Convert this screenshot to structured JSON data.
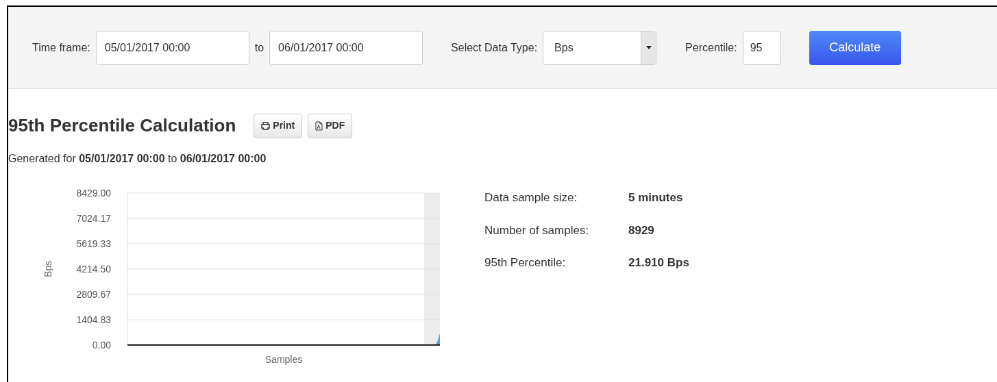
{
  "toolbar": {
    "time_frame_label": "Time frame:",
    "from": "05/01/2017 00:00",
    "to_label": "to",
    "to": "06/01/2017 00:00",
    "data_type_label": "Select Data Type:",
    "data_type": "Bps",
    "percentile_label": "Percentile:",
    "percentile": "95",
    "calculate": "Calculate"
  },
  "report": {
    "title": "95th Percentile Calculation",
    "buttons": [
      {
        "kind": "print",
        "label": "Print"
      },
      {
        "kind": "pdf",
        "label": "PDF"
      }
    ],
    "generated": "Generated for **05/01/2017 00:00** to **06/01/2017 00:00**",
    "chart_data": {
      "type": "area",
      "xlabel": "Samples",
      "ylabel": "Bps",
      "ylim": [
        0,
        8429
      ],
      "yticks": [
        {
          "value": 0,
          "label": "0.00"
        },
        {
          "value": 1404.83,
          "label": "1404.83"
        },
        {
          "value": 2809.67,
          "label": "2809.67"
        },
        {
          "value": 4214.5,
          "label": "4214.50"
        },
        {
          "value": 5619.33,
          "label": "5619.33"
        },
        {
          "value": 7024.17,
          "label": "7024.17"
        },
        {
          "value": 8429,
          "label": "8429.00"
        }
      ],
      "grid": true,
      "series": [
        {
          "color": "#5b9ee8",
          "values": [
            0,
            0,
            0,
            0,
            0,
            0,
            0,
            0,
            0,
            0,
            0,
            0,
            0,
            0,
            0,
            0,
            0,
            0,
            0,
            0,
            0,
            0,
            0,
            0,
            0,
            0,
            0,
            0,
            0,
            0,
            0,
            0,
            0,
            0,
            0,
            0,
            0,
            0,
            0,
            0,
            0,
            0,
            0,
            0,
            0,
            0,
            0,
            0,
            0,
            0,
            0,
            0,
            0,
            0,
            0,
            0,
            0,
            0,
            0,
            0,
            0,
            0,
            0,
            0,
            0,
            0,
            0,
            0,
            0,
            0,
            0,
            0,
            0,
            0,
            0,
            0,
            0,
            0,
            0,
            0,
            0,
            0,
            0,
            0,
            0,
            0,
            0,
            0,
            0,
            0,
            0,
            0,
            0,
            0,
            0,
            0,
            0,
            0,
            0,
            100,
            650
          ]
        }
      ]
    },
    "stats": [
      {
        "label": "Data sample size:",
        "value": "5 minutes"
      },
      {
        "label": "Number of samples:",
        "value": "8929"
      },
      {
        "label": "95th Percentile:",
        "value": "21.910 Bps"
      }
    ]
  }
}
